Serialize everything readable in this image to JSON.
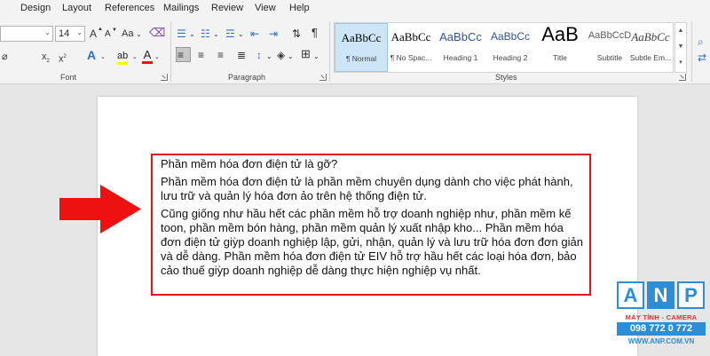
{
  "menu": {
    "tabs": [
      "Design",
      "Layout",
      "References",
      "Mailings",
      "Review",
      "View",
      "Help"
    ]
  },
  "ribbon": {
    "font": {
      "label": "Font",
      "font_name_value": "",
      "font_size_value": "14",
      "grow_font": "A",
      "shrink_font": "A",
      "case_label": "Aa",
      "subscript": "x",
      "superscript": "x",
      "text_effects": "A",
      "highlight": "ab",
      "font_color": "A"
    },
    "paragraph": {
      "label": "Paragraph",
      "pilcrow": "¶"
    },
    "styles": {
      "label": "Styles",
      "items": [
        {
          "preview": "AaBbCc",
          "name": "¶ Normal"
        },
        {
          "preview": "AaBbCc",
          "name": "¶ No Spac..."
        },
        {
          "preview": "AaBbCc",
          "name": "Heading 1"
        },
        {
          "preview": "AaBbCc",
          "name": "Heading 2"
        },
        {
          "preview": "AaB",
          "name": "Title"
        },
        {
          "preview": "AaBbCcD",
          "name": "Subtitle"
        },
        {
          "preview": "AaBbCc",
          "name": "Subtle Em..."
        }
      ]
    }
  },
  "document": {
    "paragraphs": [
      "Phần mềm hóa đơn điện tử là gỡ?",
      "Phần mềm hóa đơn điện tử là phần mềm chuyên dụng dành cho việc phát hành, lưu trữ và quản lý hóa đơn ảo trên hệ thống điện tử.",
      "Cũng giống như hầu hết các phần mềm hỗ trợ doanh nghiệp như, phần mềm kế toon, phần mềm bón hàng, phần mềm quản lý xuất nhập kho... Phần mềm hóa đơn điện tử giỳp doanh nghiệp lập, gửi, nhận, quản lý và lưu trữ hóa đơn đơn giản và dễ dàng. Phần mềm hóa đơn điện tử EIV hỗ trợ hầu hết các loại hóa đơn, bảo cảo thuế giỳp doanh nghiệp dễ dàng thực hiện nghiệp vụ nhất."
    ]
  },
  "watermark": {
    "letters": [
      "A",
      "N",
      "P"
    ],
    "tagline": "MÁY TÍNH - CAMERA",
    "phone": "098 772 0 772",
    "website": "WWW.ANP.COM.VN"
  },
  "colors": {
    "highlight_border": "#e11515",
    "arrow": "#ee1111",
    "logo_blue": "#2d8ed8",
    "selected_style": "#cde6f7"
  },
  "icons": [
    "dropdown-icon",
    "bullets-icon",
    "numbering-icon",
    "multilevel-list-icon",
    "decrease-indent-icon",
    "increase-indent-icon",
    "sort-icon",
    "align-left-icon",
    "align-center-icon",
    "align-right-icon",
    "justify-icon",
    "line-spacing-icon",
    "shading-icon",
    "borders-icon",
    "clear-formatting-icon",
    "arrow-right-icon"
  ]
}
